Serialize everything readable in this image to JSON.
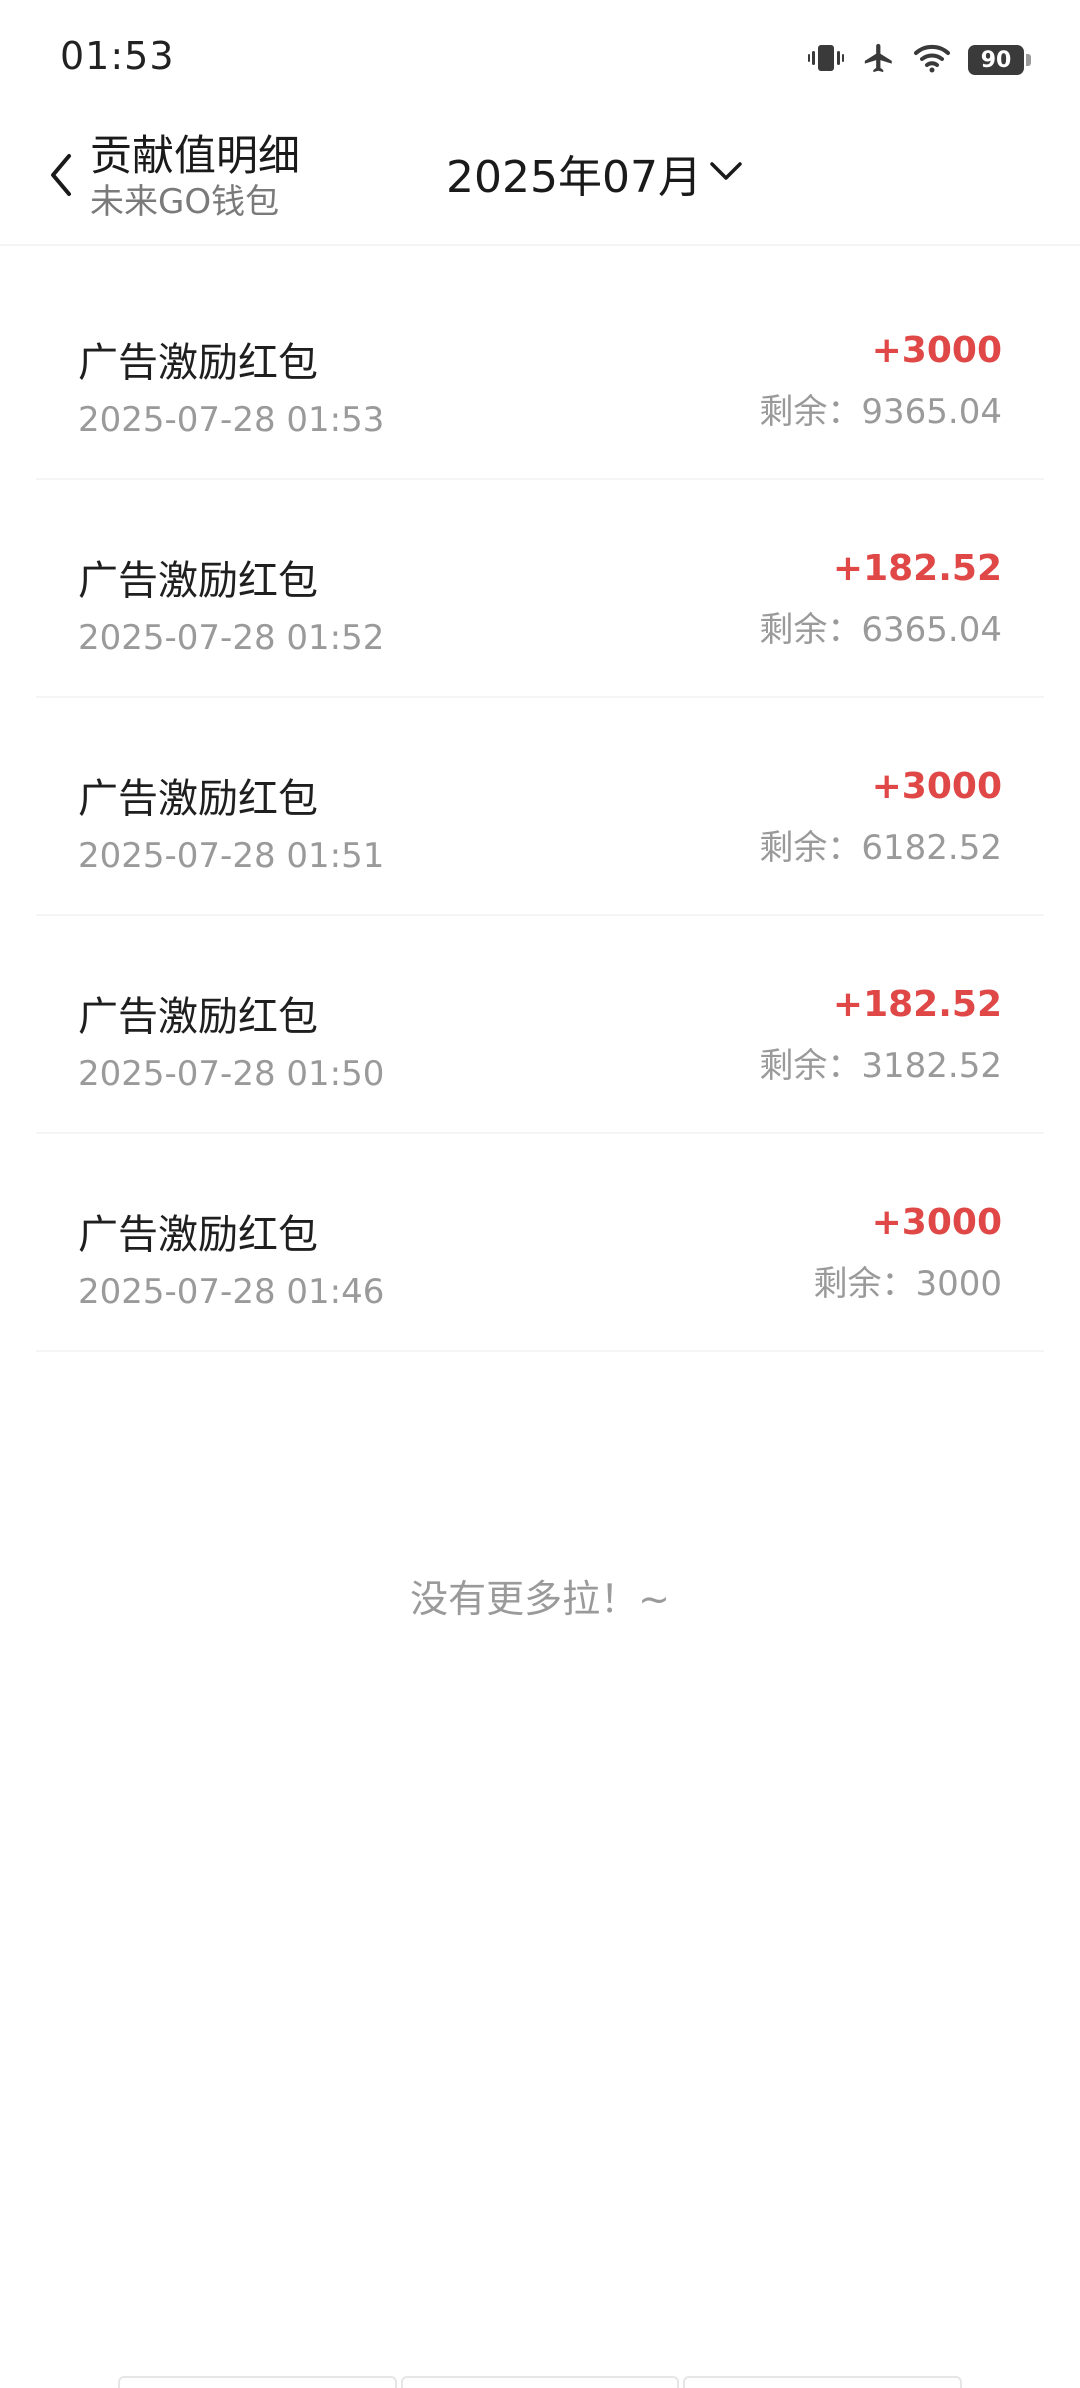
{
  "status_bar": {
    "time": "01:53",
    "battery": "90",
    "icons": [
      "vibrate-icon",
      "airplane-icon",
      "wifi-icon",
      "battery-icon"
    ]
  },
  "header": {
    "back_icon": "chevron-left-icon",
    "title": "贡献值明细",
    "subtitle": "未来GO钱包",
    "month": "2025年07月",
    "month_icon": "chevron-down-icon"
  },
  "records": [
    {
      "title": "广告激励红包",
      "time": "2025-07-28 01:53",
      "amount": "+3000",
      "balance": "剩余：9365.04"
    },
    {
      "title": "广告激励红包",
      "time": "2025-07-28 01:52",
      "amount": "+182.52",
      "balance": "剩余：6365.04"
    },
    {
      "title": "广告激励红包",
      "time": "2025-07-28 01:51",
      "amount": "+3000",
      "balance": "剩余：6182.52"
    },
    {
      "title": "广告激励红包",
      "time": "2025-07-28 01:50",
      "amount": "+182.52",
      "balance": "剩余：3182.52"
    },
    {
      "title": "广告激励红包",
      "time": "2025-07-28 01:46",
      "amount": "+3000",
      "balance": "剩余：3000"
    }
  ],
  "footer": {
    "no_more": "没有更多拉！~"
  },
  "colors": {
    "amount": "#e04848",
    "secondary_text": "#9a9a9a"
  }
}
